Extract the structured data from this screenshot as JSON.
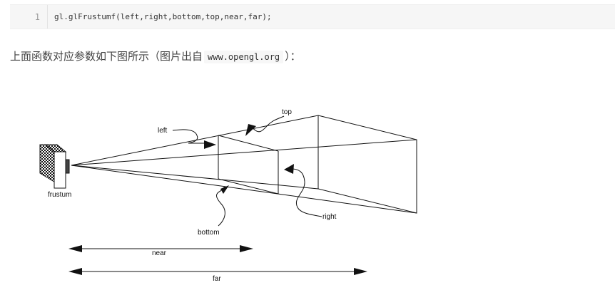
{
  "code_block": {
    "line_number": "1",
    "code": "gl.glFrustumf(left,right,bottom,top,near,far);"
  },
  "paragraph": {
    "text_before": "上面函数对应参数如下图所示（图片出自",
    "inline_code": "www.opengl.org",
    "text_after": "）："
  },
  "figure": {
    "labels": {
      "top": "top",
      "left": "left",
      "right": "right",
      "bottom": "bottom",
      "frustum": "frustum",
      "near": "near",
      "far": "far"
    }
  }
}
